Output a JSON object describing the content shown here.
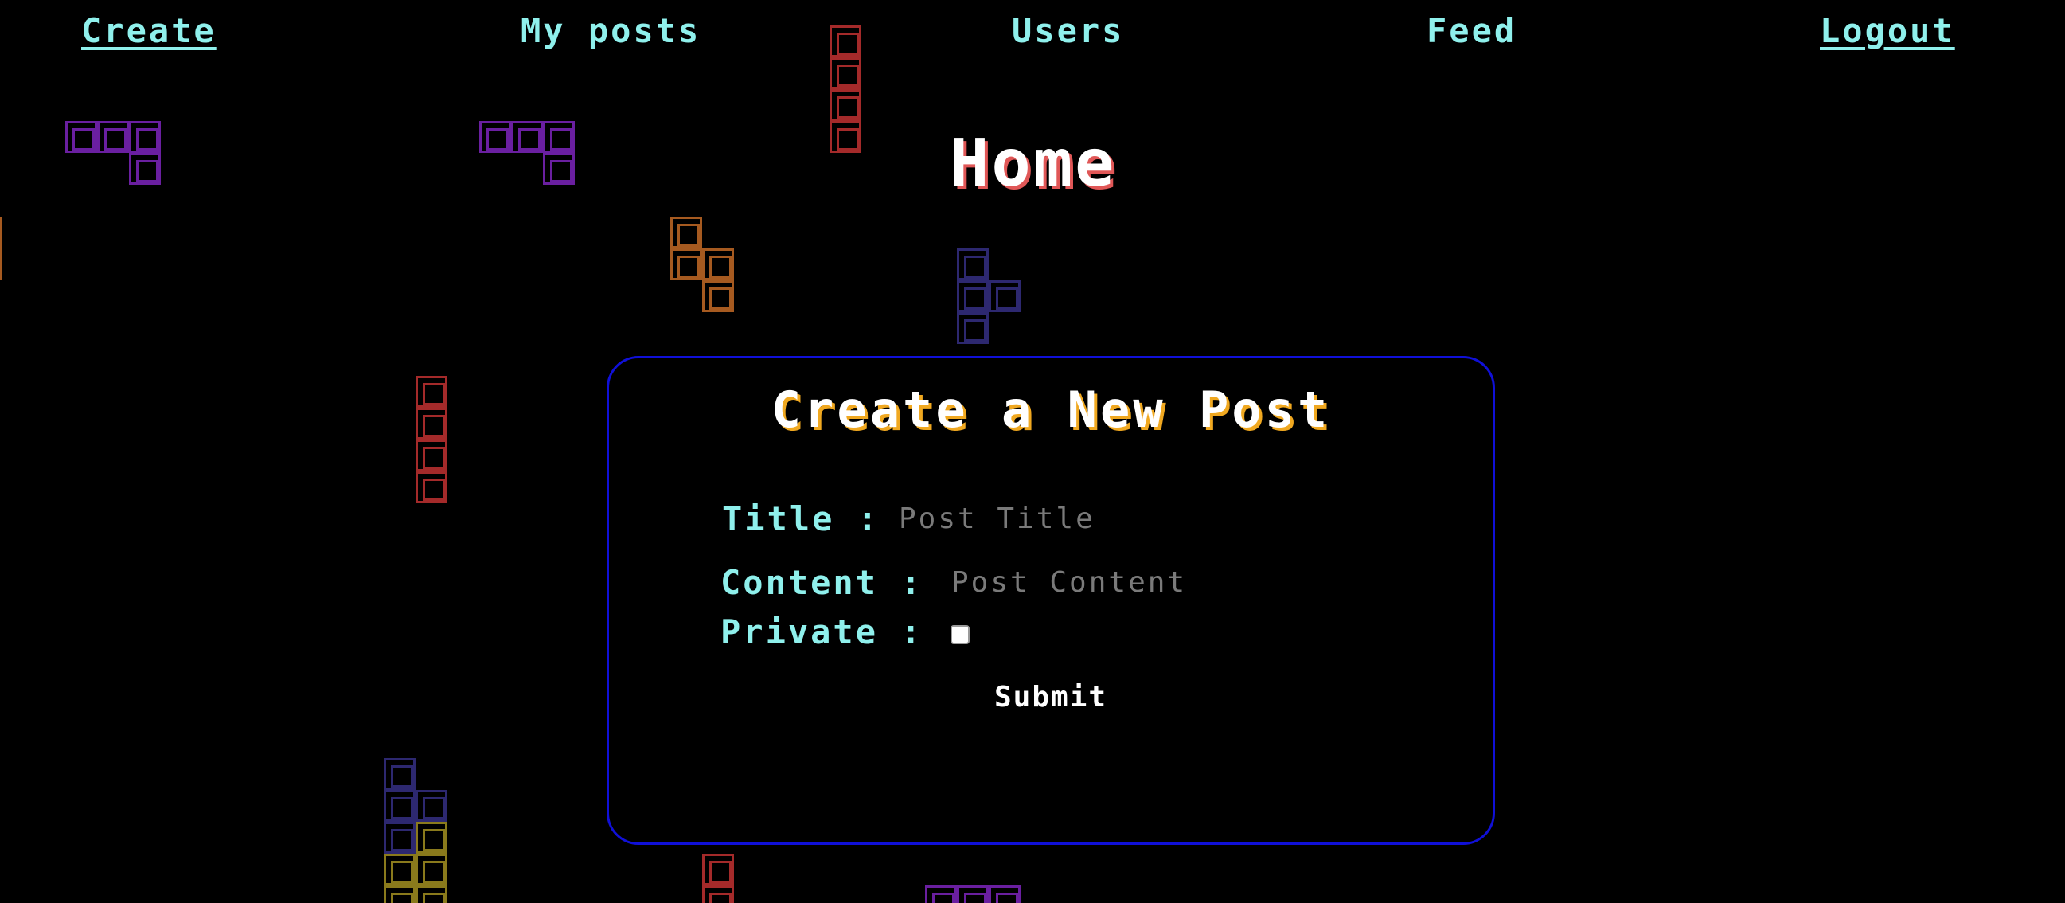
{
  "nav": {
    "create": "Create",
    "my_posts": "My posts",
    "users": "Users",
    "feed": "Feed",
    "logout": "Logout"
  },
  "page": {
    "title": "Home"
  },
  "form": {
    "heading": "Create a New Post",
    "title_label": "Title :",
    "title_placeholder": "Post Title",
    "content_label": "Content :",
    "content_placeholder": "Post Content",
    "private_label": "Private :",
    "private_checked": false,
    "submit_label": "Submit"
  },
  "colors": {
    "background": "#000000",
    "nav_text": "#8ff0ec",
    "title_shadow": "#e05757",
    "card_border": "#1010d8",
    "heading_shadow": "#f0a820",
    "block_purple": "#6a1fa0",
    "block_red": "#a42a2a",
    "block_orange": "#a65a20",
    "block_navy": "#2d2870",
    "block_olive": "#8a7a1c"
  },
  "decor": {
    "tetris_colors": [
      "purple",
      "red",
      "orange",
      "navy",
      "olive"
    ]
  }
}
